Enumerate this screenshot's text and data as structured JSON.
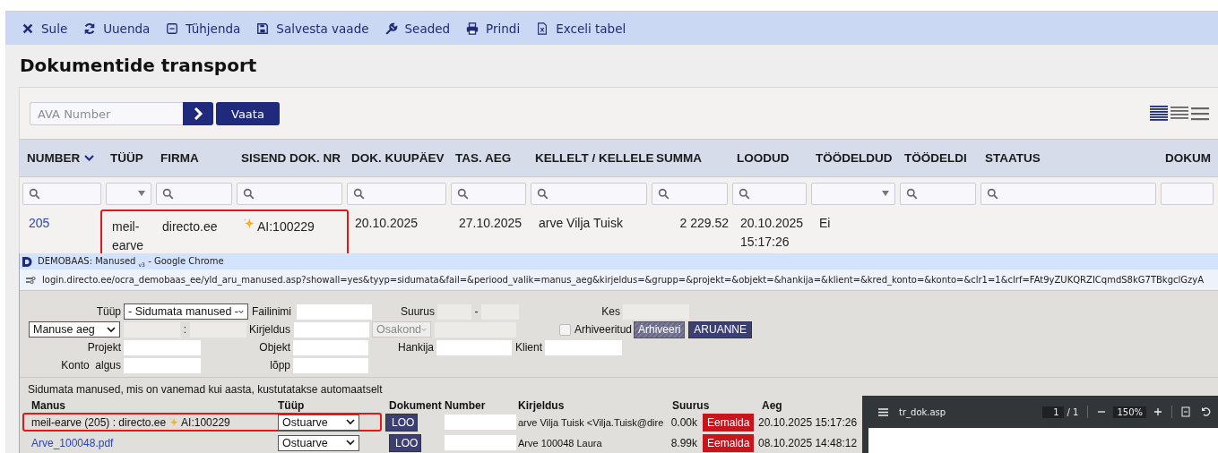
{
  "toolbar": [
    {
      "kind": "close",
      "label": "Sule"
    },
    {
      "kind": "refresh",
      "label": "Uuenda"
    },
    {
      "kind": "clear",
      "label": "Tühjenda"
    },
    {
      "kind": "save",
      "label": "Salvesta vaade"
    },
    {
      "kind": "settings",
      "label": "Seaded"
    },
    {
      "kind": "print",
      "label": "Prindi"
    },
    {
      "kind": "excel",
      "label": "Exceli tabel"
    }
  ],
  "page_title": "Dokumentide transport",
  "search": {
    "placeholder": "AVA Number",
    "button": "Vaata"
  },
  "table": {
    "columns": [
      {
        "label": "NUMBER",
        "sorted": true,
        "search_icon": true,
        "dropdown": false
      },
      {
        "label": "TÜÜP",
        "sorted": false,
        "search_icon": false,
        "dropdown": true
      },
      {
        "label": "FIRMA",
        "sorted": false,
        "search_icon": true,
        "dropdown": false
      },
      {
        "label": "SISEND DOK. NR",
        "sorted": false,
        "search_icon": true,
        "dropdown": false
      },
      {
        "label": "DOK. KUUPÄEV",
        "sorted": false,
        "search_icon": true,
        "dropdown": false
      },
      {
        "label": "TAS. AEG",
        "sorted": false,
        "search_icon": true,
        "dropdown": false
      },
      {
        "label": "KELLELT / KELLELE",
        "sorted": false,
        "search_icon": true,
        "dropdown": false
      },
      {
        "label": "SUMMA",
        "sorted": false,
        "search_icon": true,
        "dropdown": false
      },
      {
        "label": "LOODUD",
        "sorted": false,
        "search_icon": true,
        "dropdown": false
      },
      {
        "label": "TÖÖDELDUD",
        "sorted": false,
        "search_icon": false,
        "dropdown": true
      },
      {
        "label": "TÖÖDELDI",
        "sorted": false,
        "search_icon": true,
        "dropdown": false
      },
      {
        "label": "STAATUS",
        "sorted": false,
        "search_icon": true,
        "dropdown": false
      },
      {
        "label": "DOKUM",
        "sorted": false,
        "search_icon": false,
        "dropdown": false
      }
    ],
    "rows": [
      {
        "cells": [
          {
            "kind": "link",
            "text": "205",
            "highlighted": false
          },
          {
            "kind": "text",
            "text": "meil-earve",
            "highlighted": true
          },
          {
            "kind": "text",
            "text": "directo.ee",
            "highlighted": true
          },
          {
            "kind": "ai",
            "text": "AI:100229",
            "highlighted": true
          },
          {
            "kind": "text",
            "text": "20.10.2025",
            "highlighted": false
          },
          {
            "kind": "text",
            "text": "27.10.2025",
            "highlighted": false
          },
          {
            "kind": "text",
            "text": "arve Vilja Tuisk",
            "highlighted": false
          },
          {
            "kind": "number",
            "text": "2 229.52",
            "highlighted": false
          },
          {
            "kind": "text",
            "text": "20.10.2025 15:17:26",
            "highlighted": false
          },
          {
            "kind": "text",
            "text": "Ei",
            "highlighted": false
          }
        ]
      }
    ]
  },
  "popup": {
    "title": "DEMOBAAS: Manused",
    "title_sub": "v3",
    "title_suffix": "- Google Chrome",
    "url": "login.directo.ee/ocra_demobaas_ee/yld_aru_manused.asp?showall=yes&tyyp=sidumata&fail=&periood_valik=manus_aeg&kirjeldus=&grupp=&projekt=&objekt=&hankija=&klient=&kred_konto=&konto=&clr1=1&clrf=FAt9yZUKQRZICqmdS8kG7TBkgclGzyA",
    "form": {
      "tyyp_label": "Tüüp",
      "tyyp_value": "- Sidumata manused -",
      "failinimi_label": "Failinimi",
      "suurus_label": "Suurus",
      "suurus_sep": "-",
      "kes_label": "Kes",
      "period_value": "Manuse aeg",
      "period_sep": ":",
      "kirjeldus_label": "Kirjeldus",
      "osakond_placeholder": "Osakond",
      "arhiveeritud_label": "Arhiveeritud",
      "arhiveeritud_checked": false,
      "arhiveeri_button": "Arhiveeri",
      "aruanne_button": "ARUANNE",
      "projekt_label": "Projekt",
      "objekt_label": "Objekt",
      "hankija_label": "Hankija",
      "klient_label": "Klient",
      "konto_label": "Konto  algus",
      "lopp_label": "lõpp"
    },
    "notice": "Sidumata manused, mis on vanemad kui aasta, kustutatakse automaatselt",
    "columns": [
      "Manus",
      "Tüüp",
      "Dokument",
      "Number",
      "Kirjeldus",
      "Suurus",
      "Aeg"
    ],
    "rows": [
      {
        "highlighted": true,
        "kind": "text",
        "manus": "meil-earve (205) : directo.ee",
        "ai_tag": "AI:100229",
        "type": "Ostuarve",
        "loo": "LOO",
        "kirjeldus": "arve Vilja Tuisk <Vilja.Tuisk@dire",
        "suurus": "0.00k",
        "remove": "Eemalda",
        "aeg": "20.10.2025 15:17:26"
      },
      {
        "highlighted": false,
        "kind": "link",
        "manus": "Arve_100048.pdf",
        "type": "Ostuarve",
        "loo": "LOO",
        "kirjeldus": "Arve 100048 Laura",
        "suurus": "8.99k",
        "remove": "Eemalda",
        "aeg": "08.10.2025 14:48:12"
      }
    ],
    "viewer": {
      "file": "tr_dok.asp",
      "page": "1",
      "pages": "/ 1",
      "zoom": "150%"
    }
  }
}
